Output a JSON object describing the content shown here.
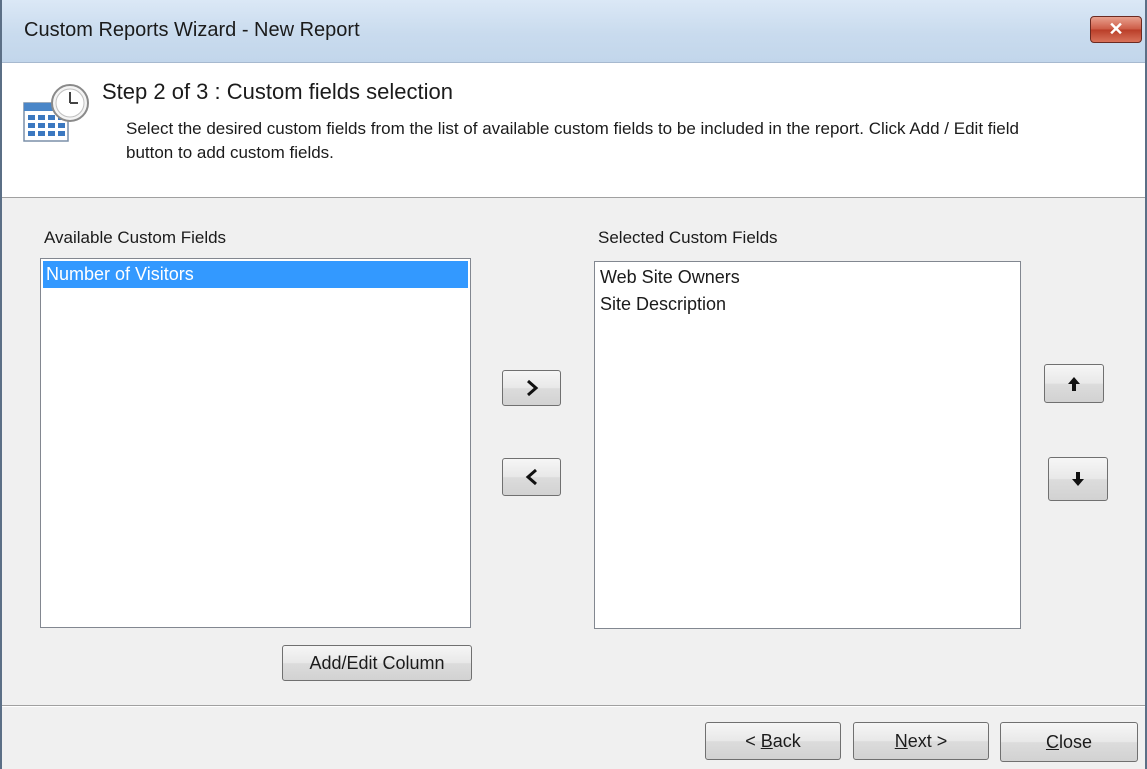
{
  "window": {
    "title": "Custom Reports Wizard - New Report",
    "close_glyph": "✕"
  },
  "header": {
    "icon": "calendar-clock-icon",
    "step_title": "Step 2 of 3 : Custom fields selection",
    "description": "Select the desired custom fields from the list of available custom fields to be included in the report. Click Add / Edit field button to add custom fields."
  },
  "available": {
    "label": "Available Custom Fields",
    "items": [
      "Number of Visitors"
    ],
    "selected_index": 0
  },
  "selected": {
    "label": "Selected Custom Fields",
    "items": [
      "Web Site Owners",
      "Site Description"
    ]
  },
  "buttons": {
    "add_edit": "Add/Edit Column",
    "move_right": "chevron-right-icon",
    "move_left": "chevron-left-icon",
    "move_up": "arrow-up-icon",
    "move_down": "arrow-down-icon",
    "back_prefix": "< ",
    "back_mnemonic": "B",
    "back_rest": "ack",
    "next_mnemonic": "N",
    "next_rest": "ext >",
    "close_mnemonic": "C",
    "close_rest": "lose"
  },
  "colors": {
    "selection": "#3399ff",
    "titlebar": "#c9dbee",
    "close_button": "#cc5a44"
  }
}
